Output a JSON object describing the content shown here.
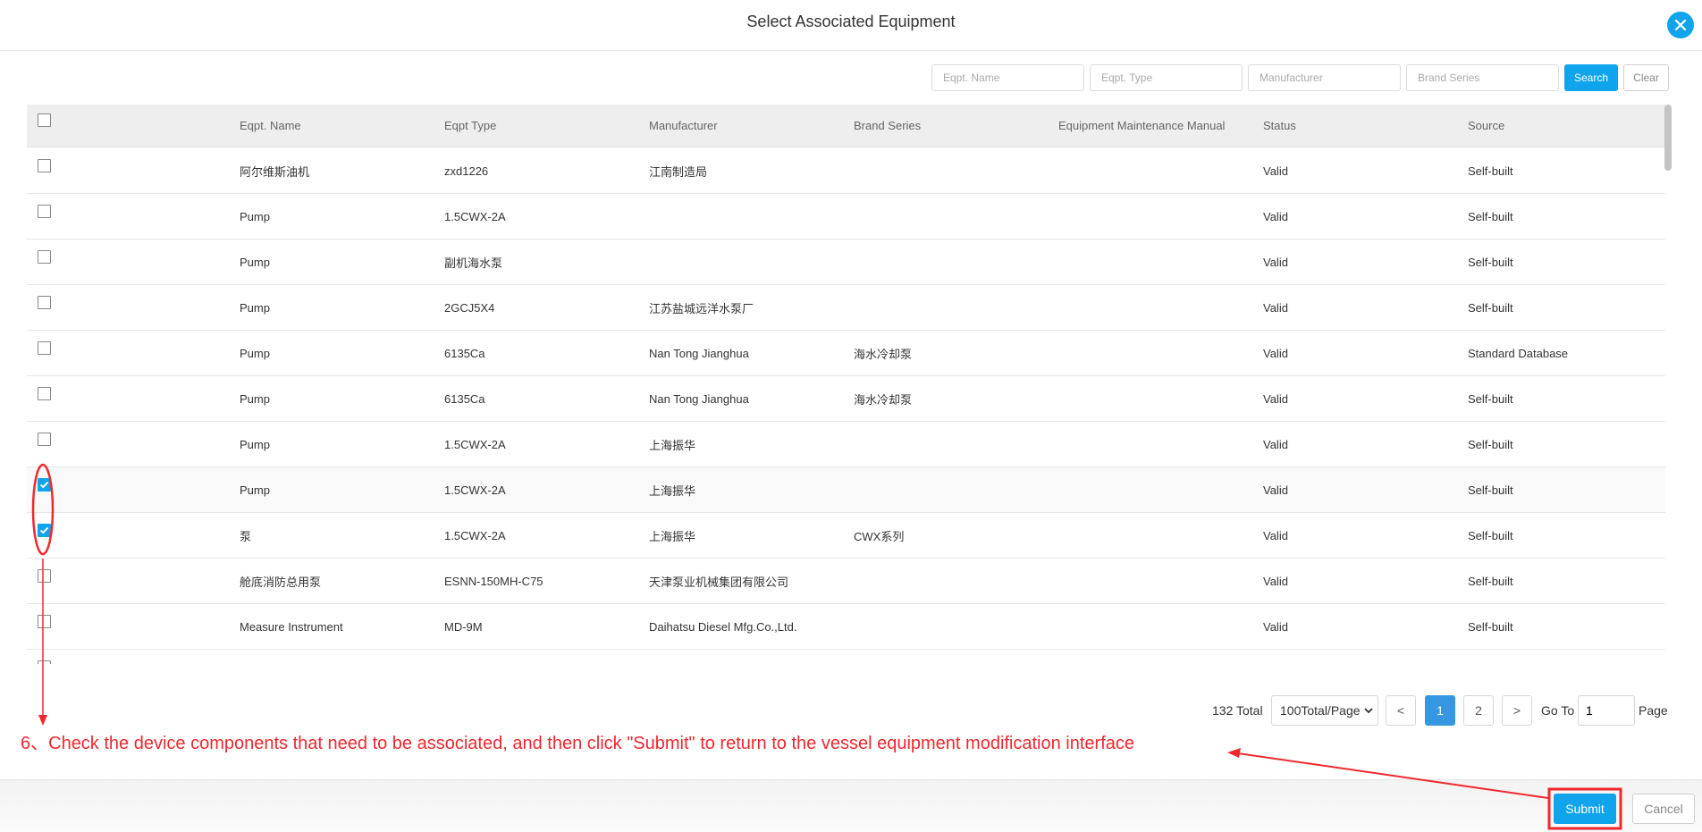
{
  "dialog": {
    "title": "Select Associated Equipment",
    "close_icon": "close-icon"
  },
  "search": {
    "fields": [
      {
        "name": "eqpt-name",
        "placeholder": "Eqpt. Name",
        "value": ""
      },
      {
        "name": "eqpt-type",
        "placeholder": "Eqpt. Type",
        "value": ""
      },
      {
        "name": "manufacturer",
        "placeholder": "Manufacturer",
        "value": ""
      },
      {
        "name": "brand-series",
        "placeholder": "Brand Series",
        "value": ""
      }
    ],
    "search_label": "Search",
    "clear_label": "Clear"
  },
  "table": {
    "columns": [
      "Eqpt. Name",
      "Eqpt Type",
      "Manufacturer",
      "Brand Series",
      "Equipment Maintenance Manual",
      "Status",
      "Source"
    ],
    "select_all_checked": false,
    "rows": [
      {
        "checked": false,
        "name": "阿尔维斯油机",
        "type": "zxd1226",
        "manufacturer": "江南制造局",
        "brand": "",
        "manual": "",
        "status": "Valid",
        "source": "Self-built"
      },
      {
        "checked": false,
        "name": "Pump",
        "type": "1.5CWX-2A",
        "manufacturer": "",
        "brand": "",
        "manual": "",
        "status": "Valid",
        "source": "Self-built"
      },
      {
        "checked": false,
        "name": "Pump",
        "type": "副机海水泵",
        "manufacturer": "",
        "brand": "",
        "manual": "",
        "status": "Valid",
        "source": "Self-built"
      },
      {
        "checked": false,
        "name": "Pump",
        "type": "2GCJ5X4",
        "manufacturer": "江苏盐城远洋水泵厂",
        "brand": "",
        "manual": "",
        "status": "Valid",
        "source": "Self-built"
      },
      {
        "checked": false,
        "name": "Pump",
        "type": "6135Ca",
        "manufacturer": "Nan Tong Jianghua",
        "brand": "海水冷却泵",
        "manual": "",
        "status": "Valid",
        "source": "Standard Database"
      },
      {
        "checked": false,
        "name": "Pump",
        "type": "6135Ca",
        "manufacturer": "Nan Tong Jianghua",
        "brand": "海水冷却泵",
        "manual": "",
        "status": "Valid",
        "source": "Self-built"
      },
      {
        "checked": false,
        "name": "Pump",
        "type": "1.5CWX-2A",
        "manufacturer": "上海振华",
        "brand": "",
        "manual": "",
        "status": "Valid",
        "source": "Self-built"
      },
      {
        "checked": true,
        "name": "Pump",
        "type": "1.5CWX-2A",
        "manufacturer": "上海振华",
        "brand": "",
        "manual": "",
        "status": "Valid",
        "source": "Self-built"
      },
      {
        "checked": true,
        "name": "泵",
        "type": "1.5CWX-2A",
        "manufacturer": "上海振华",
        "brand": "CWX系列",
        "manual": "",
        "status": "Valid",
        "source": "Self-built"
      },
      {
        "checked": false,
        "name": "舱底消防总用泵",
        "type": "ESNN-150MH-C75",
        "manufacturer": "天津泵业机械集团有限公司",
        "brand": "",
        "manual": "",
        "status": "Valid",
        "source": "Self-built"
      },
      {
        "checked": false,
        "name": "Measure Instrument",
        "type": "MD-9M",
        "manufacturer": "Daihatsu Diesel Mfg.Co.,Ltd.",
        "brand": "",
        "manual": "",
        "status": "Valid",
        "source": "Self-built"
      },
      {
        "checked": false,
        "name": "",
        "type": "",
        "manufacturer": "",
        "brand": "",
        "manual": "",
        "status": "",
        "source": ""
      }
    ]
  },
  "pagination": {
    "total_label": "132 Total",
    "page_size": "100Total/Page",
    "prev": "<",
    "pages": [
      "1",
      "2"
    ],
    "current_page": "1",
    "next": ">",
    "goto_label": "Go To",
    "goto_value": "1",
    "page_label": "Page"
  },
  "annotation": {
    "text": "6、Check the device components that need to be associated, and then click \"Submit\" to return to the vessel equipment modification interface",
    "color": "#f0282d"
  },
  "footer": {
    "submit_label": "Submit",
    "cancel_label": "Cancel"
  },
  "colors": {
    "accent": "#10a4ec",
    "page_active": "#3497e0",
    "annotation": "#f0282d"
  }
}
